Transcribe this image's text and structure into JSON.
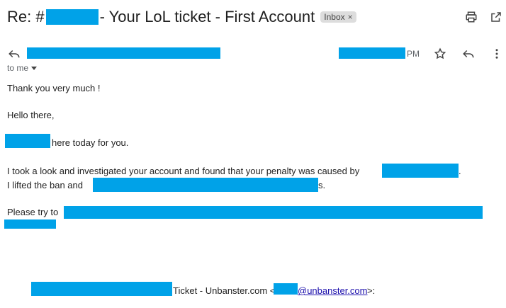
{
  "header": {
    "subject_prefix": "Re: #",
    "subject_suffix": "- Your LoL ticket - First Account",
    "badge_label": "Inbox",
    "badge_close": "×"
  },
  "message_meta": {
    "time_suffix": "PM",
    "to_me": "to me"
  },
  "body": {
    "line_thanks": "Thank you very much !",
    "line_hello": "Hello there,",
    "line_here_today": "here today for you.",
    "line_investigated": "I took a look and investigated your account and found that your penalty was caused by",
    "line_investigated_end": ".",
    "line_lifted_start": "I lifted the ban and",
    "line_lifted_end": "s.",
    "line_please": "Please try to"
  },
  "footer": {
    "ticket_text": "Ticket - Unbanster.com <",
    "email_domain": "@unbanster.com",
    "email_end": ">:"
  },
  "colors": {
    "redaction": "#00a2e8",
    "link": "#1a0dab"
  },
  "icons": [
    "reply-icon",
    "print-icon",
    "open-external-icon",
    "star-icon",
    "more-vert-icon",
    "chevron-down-icon"
  ]
}
